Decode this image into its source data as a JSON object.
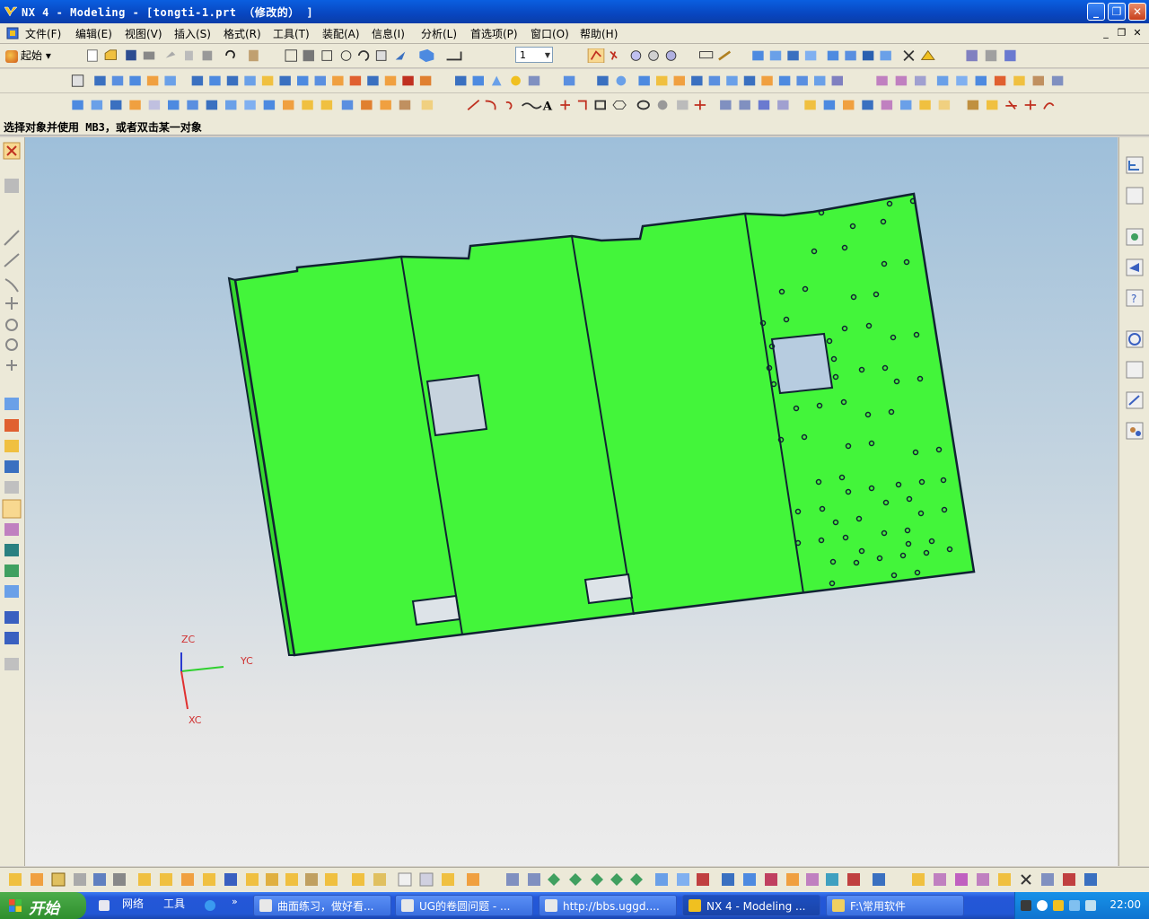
{
  "window": {
    "title": "NX 4 - Modeling - [tongti-1.prt （修改的） ]",
    "buttons": [
      "_",
      "❐",
      "✕"
    ]
  },
  "menubar": {
    "items": [
      "文件(F)",
      "编辑(E)",
      "视图(V)",
      "插入(S)",
      "格式(R)",
      "工具(T)",
      "装配(A)",
      "信息(I)",
      "分析(L)",
      "首选项(P)",
      "窗口(O)",
      "帮助(H)"
    ],
    "mdi": [
      "_",
      "❐",
      "✕"
    ]
  },
  "toolbar": {
    "start_label": "起始",
    "layer_value": "1"
  },
  "status": {
    "prompt": "选择对象并使用 MB3，或者双击某一对象"
  },
  "axes": {
    "zc": "ZC",
    "yc": "YC",
    "xc": "XC"
  },
  "taskbar": {
    "start": "开始",
    "quick1": "网络",
    "quick2": "工具",
    "tasks": [
      "曲面练习，做好看...",
      "UG的卷圆问题 - ...",
      "http://bbs.uggd....",
      "NX 4 - Modeling ...",
      "F:\\常用软件"
    ],
    "clock": "22:00"
  },
  "colors": {
    "part_green": "#43f53a",
    "title_blue": "#0a5fe0",
    "toolbar_bg": "#ece9d8"
  }
}
